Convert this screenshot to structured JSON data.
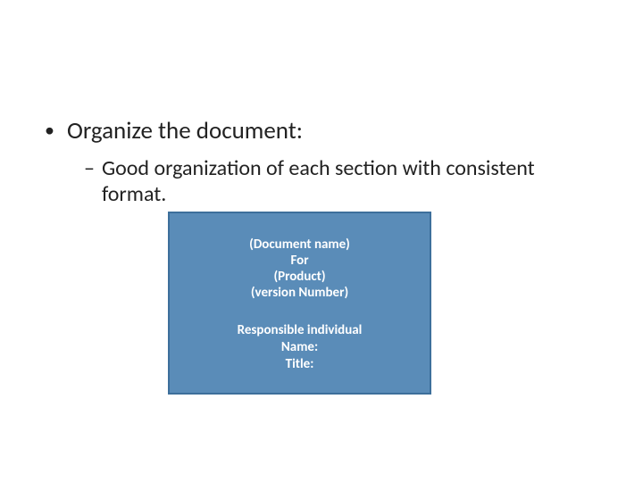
{
  "main": {
    "bullet": "Organize the document:",
    "sub": "Good organization of each section with consistent format."
  },
  "box": {
    "line1": "(Document name)",
    "line2": "For",
    "line3": "(Product)",
    "line4": "(version Number)",
    "line5": "Responsible individual",
    "line6": "Name:",
    "line7": "Title:"
  }
}
